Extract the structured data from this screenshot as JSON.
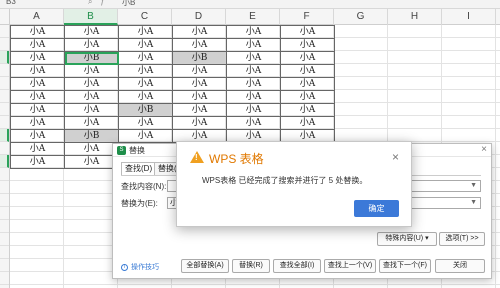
{
  "formula_bar": {
    "cell_ref": "B3",
    "icons": [
      "zoom-icon",
      "fx-icon"
    ],
    "value": "小B"
  },
  "columns": [
    "A",
    "B",
    "C",
    "D",
    "E",
    "F",
    "G",
    "H",
    "I"
  ],
  "selected_column": "B",
  "rows": [
    [
      "小A",
      "小A",
      "小A",
      "小A",
      "小A",
      "小A"
    ],
    [
      "小A",
      "小A",
      "小A",
      "小A",
      "小A",
      "小A"
    ],
    [
      "小A",
      "小B",
      "小A",
      "小B",
      "小A",
      "小A"
    ],
    [
      "小A",
      "小A",
      "小A",
      "小A",
      "小A",
      "小A"
    ],
    [
      "小A",
      "小A",
      "小A",
      "小A",
      "小A",
      "小A"
    ],
    [
      "小A",
      "小A",
      "小A",
      "小A",
      "小A",
      "小A"
    ],
    [
      "小A",
      "小A",
      "小B",
      "小A",
      "小A",
      "小A"
    ],
    [
      "小A",
      "小A",
      "小A",
      "小A",
      "小A",
      "小A"
    ],
    [
      "小A",
      "小B",
      "小A",
      "小A",
      "小A",
      "小A"
    ],
    [
      "小A",
      "小A",
      "小A",
      "小A",
      "小A",
      "小A"
    ],
    [
      "小A",
      "小A",
      "小A",
      "小A",
      "小A",
      "小A"
    ]
  ],
  "replace_dialog": {
    "logo": "S",
    "title": "替换",
    "tabs": [
      "查找(D)",
      "替换(P)"
    ],
    "find_label": "查找内容(N):",
    "find_value": "",
    "replace_label": "替换为(E):",
    "replace_value": "小A",
    "special_button": "特殊内容(U) ▾",
    "options_button": "选项(T) >>",
    "tips_link": "操作技巧",
    "buttons": [
      "全部替换(A)",
      "替换(R)",
      "查找全部(I)",
      "查找上一个(V)",
      "查找下一个(F)",
      "关闭"
    ]
  },
  "message_box": {
    "title": "WPS 表格",
    "text": "WPS表格 已经完成了搜索并进行了 5 处替换。",
    "ok_label": "确定"
  },
  "colors": {
    "accent": "#2aa35a",
    "ok_button": "#3c79d8",
    "warning": "#f0a020"
  }
}
